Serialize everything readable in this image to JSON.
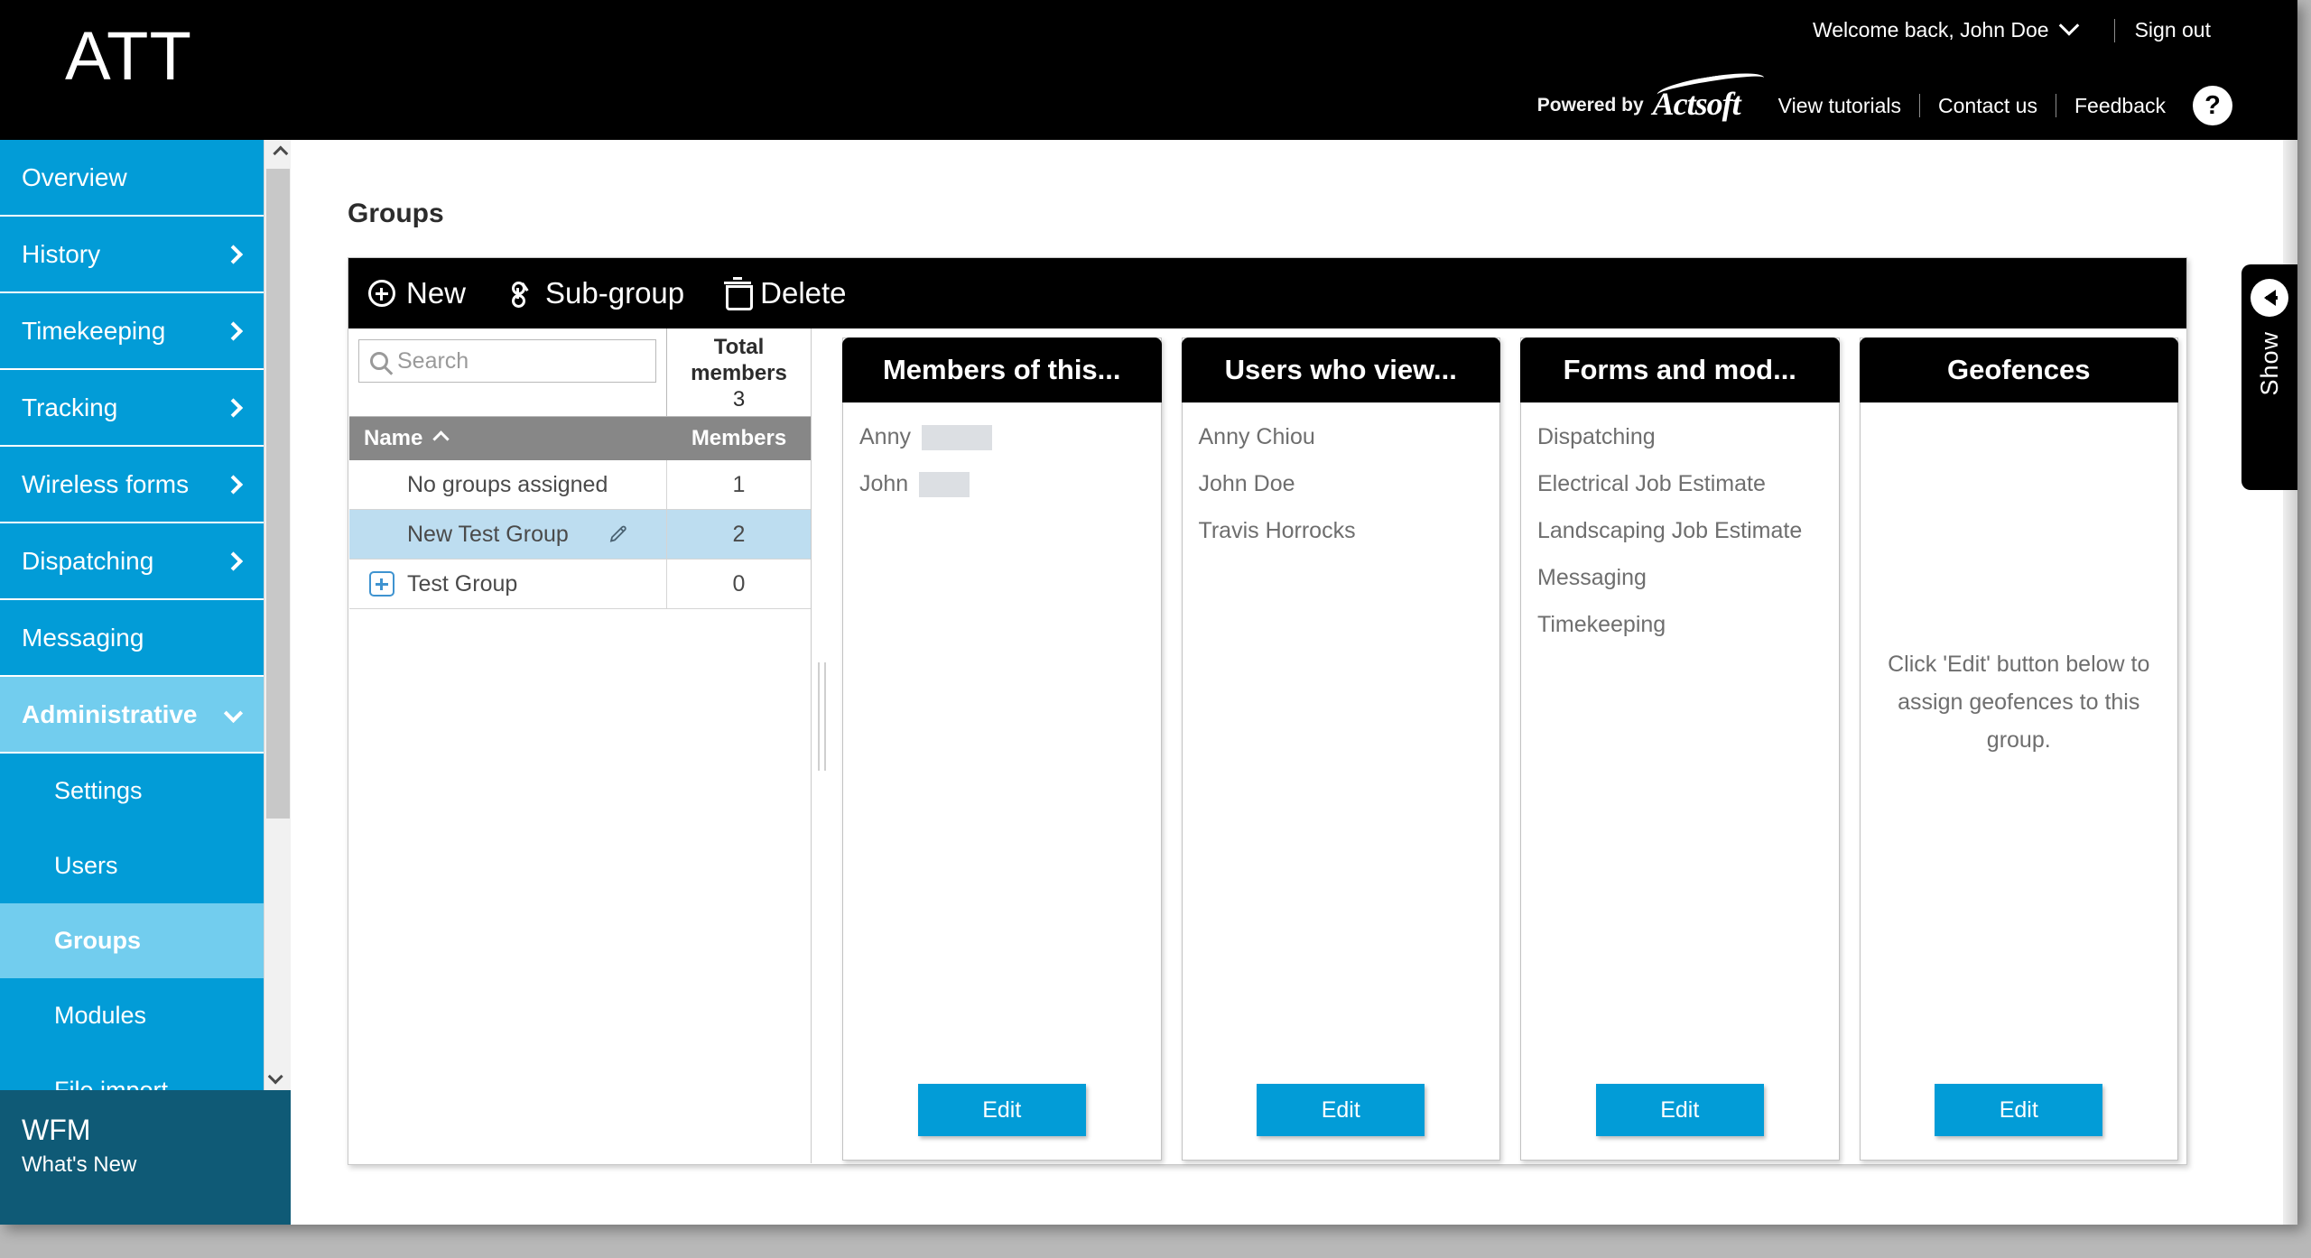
{
  "header": {
    "brand": "ATT",
    "welcome": "Welcome back, John Doe",
    "caret_icon": "chevron-down-icon",
    "sign_out": "Sign out",
    "powered_by": "Powered by",
    "actsoft": "Actsoft",
    "links": [
      "View tutorials",
      "Contact us",
      "Feedback"
    ],
    "help_label": "?"
  },
  "sidebar": {
    "items": [
      {
        "label": "Overview",
        "has_chevron": false,
        "active": false
      },
      {
        "label": "History",
        "has_chevron": true,
        "active": false
      },
      {
        "label": "Timekeeping",
        "has_chevron": true,
        "active": false
      },
      {
        "label": "Tracking",
        "has_chevron": true,
        "active": false
      },
      {
        "label": "Wireless forms",
        "has_chevron": true,
        "active": false
      },
      {
        "label": "Dispatching",
        "has_chevron": true,
        "active": false
      },
      {
        "label": "Messaging",
        "has_chevron": false,
        "active": false
      },
      {
        "label": "Administrative",
        "has_chevron": true,
        "active": true
      }
    ],
    "sub_items": [
      {
        "label": "Settings",
        "active": false
      },
      {
        "label": "Users",
        "active": false
      },
      {
        "label": "Groups",
        "active": true
      },
      {
        "label": "Modules",
        "active": false
      },
      {
        "label": "File import",
        "active": false
      }
    ],
    "footer": {
      "title": "WFM",
      "subtitle": "What's New"
    }
  },
  "main": {
    "page_title": "Groups",
    "toolbar": {
      "new_label": "New",
      "subgroup_label": "Sub-group",
      "delete_label": "Delete"
    },
    "search": {
      "placeholder": "Search"
    },
    "total_members": {
      "label_line1": "Total",
      "label_line2": "members",
      "value": "3"
    },
    "table": {
      "columns": [
        "Name",
        "Members"
      ],
      "sort_indicator": "ascending",
      "rows": [
        {
          "name": "No groups assigned",
          "members": "1",
          "selected": false,
          "expandable": false,
          "editable": false
        },
        {
          "name": "New Test Group",
          "members": "2",
          "selected": true,
          "expandable": false,
          "editable": true
        },
        {
          "name": "Test Group",
          "members": "0",
          "selected": false,
          "expandable": true,
          "editable": false
        }
      ]
    },
    "cards": [
      {
        "title": "Members of this...",
        "mode": "list",
        "items": [
          {
            "text": "Anny",
            "redacted_width": 78
          },
          {
            "text": "John",
            "redacted_width": 56
          }
        ],
        "edit_label": "Edit"
      },
      {
        "title": "Users who view...",
        "mode": "list",
        "items": [
          {
            "text": "Anny Chiou",
            "redacted_width": 0
          },
          {
            "text": "John Doe",
            "redacted_width": 0
          },
          {
            "text": "Travis Horrocks",
            "redacted_width": 0
          }
        ],
        "edit_label": "Edit"
      },
      {
        "title": "Forms and mod...",
        "mode": "list",
        "items": [
          {
            "text": "Dispatching",
            "redacted_width": 0
          },
          {
            "text": "Electrical Job Estimate",
            "redacted_width": 0
          },
          {
            "text": "Landscaping Job Estimate",
            "redacted_width": 0
          },
          {
            "text": "Messaging",
            "redacted_width": 0
          },
          {
            "text": "Timekeeping",
            "redacted_width": 0
          }
        ],
        "edit_label": "Edit"
      },
      {
        "title": "Geofences",
        "mode": "empty",
        "empty_text": "Click 'Edit' button below to assign geofences to this group.",
        "edit_label": "Edit"
      }
    ],
    "show_tab": {
      "label": "Show",
      "icon": "arrow-left-icon"
    }
  },
  "colors": {
    "brand_blue": "#029cd7",
    "active_blue": "#72cdee",
    "row_selected": "#bdddf0",
    "header_black": "#000000",
    "wfm_teal": "#0f5a76"
  }
}
